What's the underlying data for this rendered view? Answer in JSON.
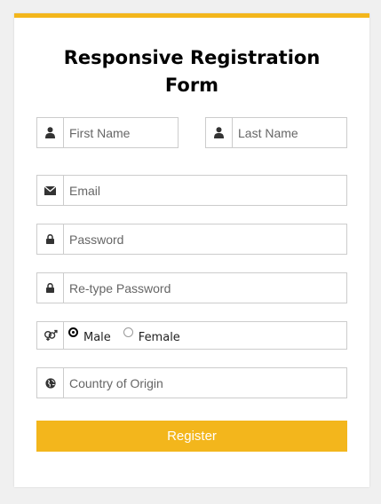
{
  "form": {
    "title_line1": "Responsive Registration",
    "title_line2": "Form",
    "fields": {
      "first_name": {
        "placeholder": "First Name",
        "icon": "user-icon"
      },
      "last_name": {
        "placeholder": "Last Name",
        "icon": "user-icon"
      },
      "email": {
        "placeholder": "Email",
        "icon": "envelope-icon"
      },
      "password": {
        "placeholder": "Password",
        "icon": "lock-icon"
      },
      "retype_password": {
        "placeholder": "Re-type Password",
        "icon": "lock-icon"
      },
      "gender": {
        "icon": "gender-icon",
        "options": [
          "Male",
          "Female"
        ],
        "selected": "Male"
      },
      "country": {
        "placeholder": "Country of Origin",
        "icon": "globe-icon"
      }
    },
    "register_label": "Register"
  },
  "colors": {
    "accent": "#f3b61c",
    "border": "#cccccc",
    "background": "#f0f0f0"
  }
}
